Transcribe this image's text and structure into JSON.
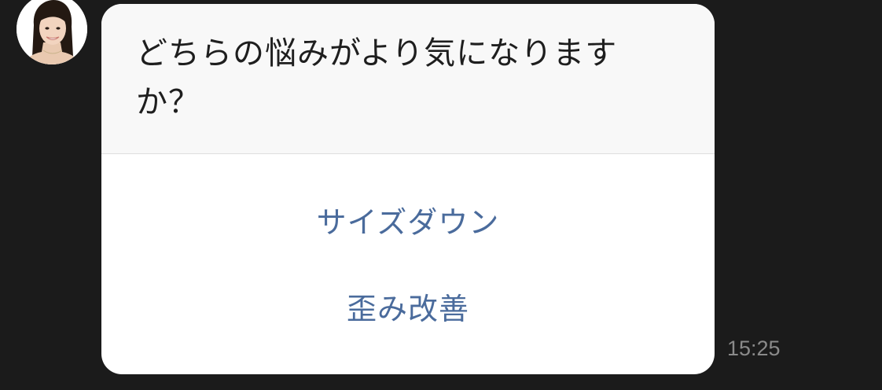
{
  "message": {
    "question": "どちらの悩みがより気になりますか？",
    "options": [
      {
        "label": "サイズダウン"
      },
      {
        "label": "歪み改善"
      }
    ],
    "timestamp": "15:25"
  },
  "colors": {
    "background": "#1b1b1b",
    "card": "#ffffff",
    "card_header": "#f8f8f8",
    "option_text": "#4a6b9c",
    "question_text": "#1e1e1e",
    "timestamp_text": "#8a8a8a"
  },
  "avatar": {
    "icon": "profile-photo-woman"
  }
}
